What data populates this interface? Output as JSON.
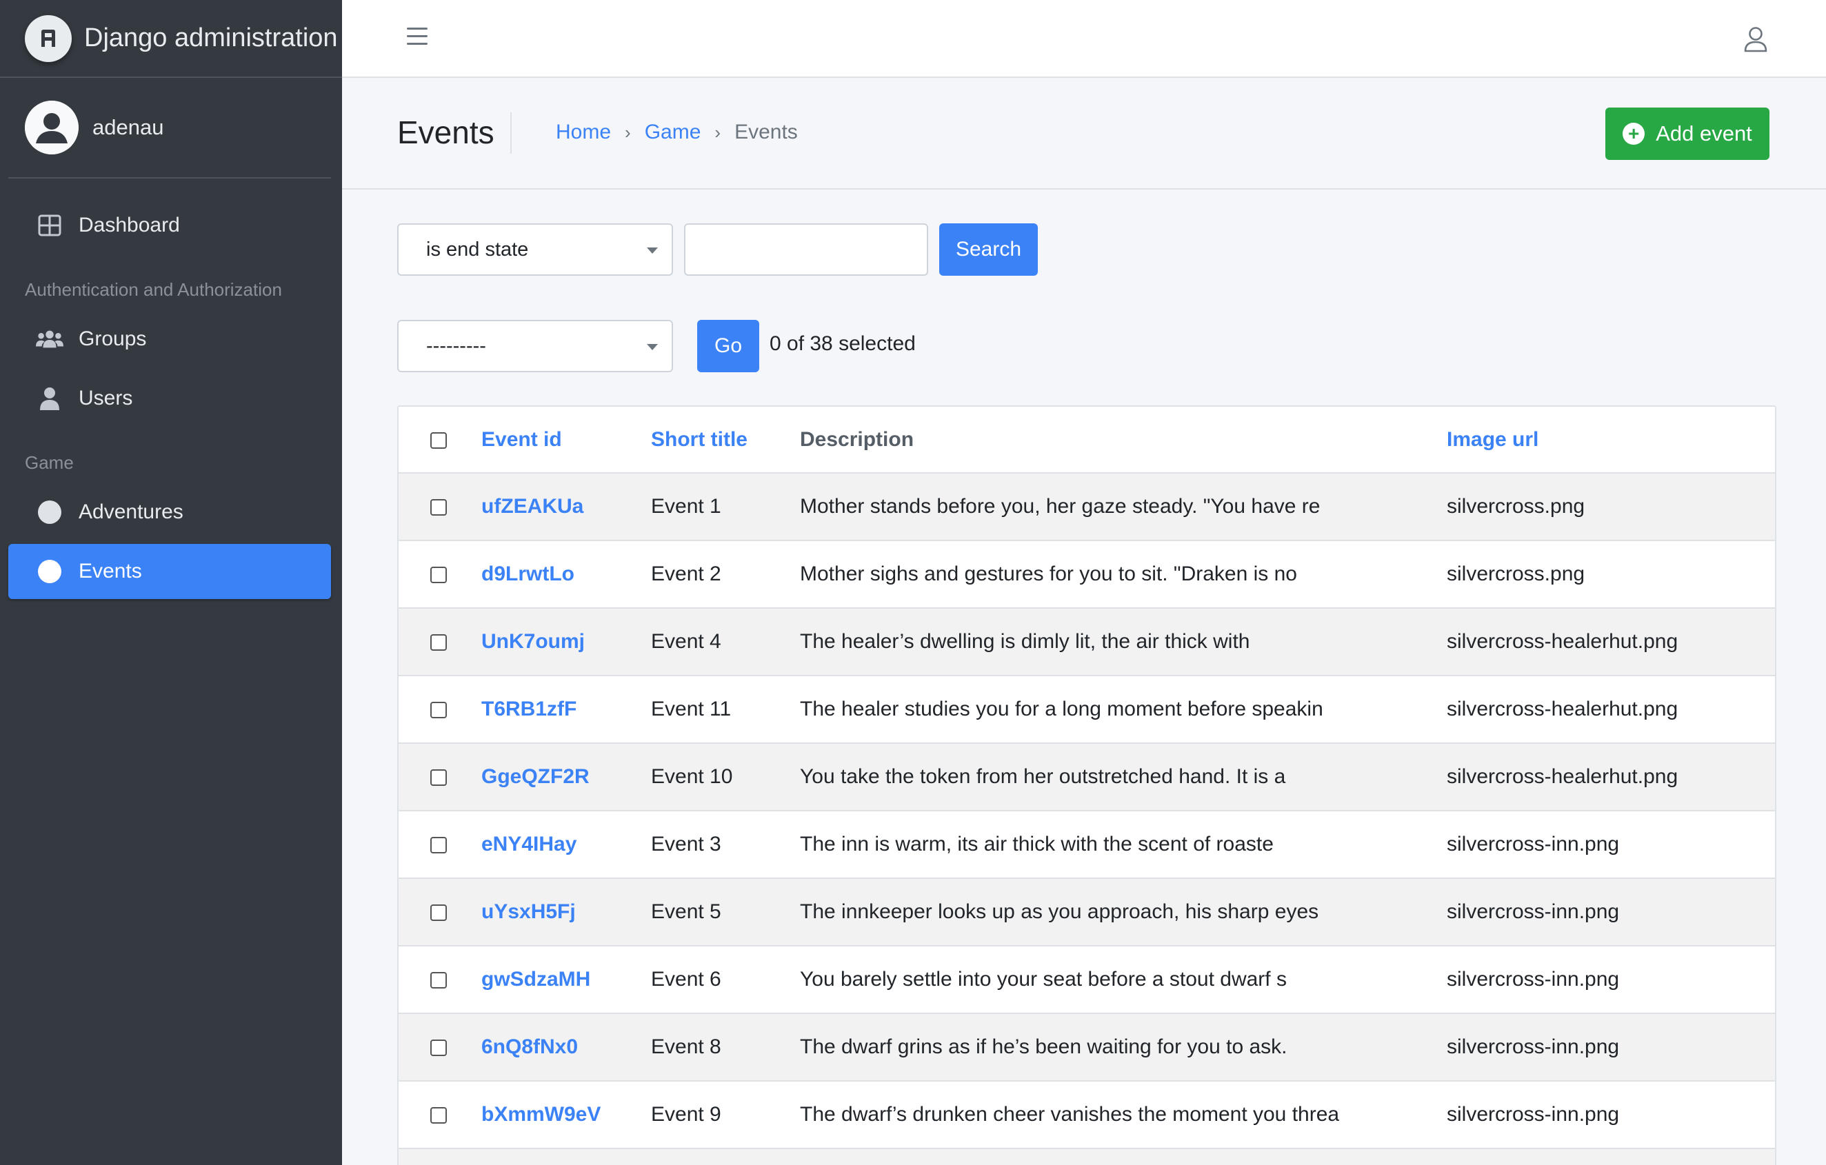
{
  "brand": {
    "title": "Django administration"
  },
  "user": {
    "name": "adenau"
  },
  "sidebar": {
    "dashboard": "Dashboard",
    "section_auth": "Authentication and Authorization",
    "groups": "Groups",
    "users": "Users",
    "section_game": "Game",
    "adventures": "Adventures",
    "events": "Events"
  },
  "header": {
    "title": "Events",
    "breadcrumb": [
      "Home",
      "Game",
      "Events"
    ],
    "add_button": "Add event"
  },
  "search": {
    "filter_value": "is end state",
    "input_value": "",
    "button": "Search"
  },
  "actions": {
    "select_value": "---------",
    "go_button": "Go",
    "selected_count": "0 of 38 selected"
  },
  "table": {
    "columns": [
      "Event id",
      "Short title",
      "Description",
      "Image url"
    ],
    "rows": [
      {
        "id": "ufZEAKUa",
        "title": "Event 1",
        "description": "Mother stands before you, her gaze steady. \"You have re",
        "image": "silvercross.png"
      },
      {
        "id": "d9LrwtLo",
        "title": "Event 2",
        "description": "Mother sighs and gestures for you to sit. \"Draken is no",
        "image": "silvercross.png"
      },
      {
        "id": "UnK7oumj",
        "title": "Event 4",
        "description": "The healer’s dwelling is dimly lit, the air thick with",
        "image": "silvercross-healerhut.png"
      },
      {
        "id": "T6RB1zfF",
        "title": "Event 11",
        "description": "The healer studies you for a long moment before speakin",
        "image": "silvercross-healerhut.png"
      },
      {
        "id": "GgeQZF2R",
        "title": "Event 10",
        "description": "You take the token from her outstretched hand. It is a",
        "image": "silvercross-healerhut.png"
      },
      {
        "id": "eNY4IHay",
        "title": "Event 3",
        "description": "The inn is warm, its air thick with the scent of roaste",
        "image": "silvercross-inn.png"
      },
      {
        "id": "uYsxH5Fj",
        "title": "Event 5",
        "description": "The innkeeper looks up as you approach, his sharp eyes",
        "image": "silvercross-inn.png"
      },
      {
        "id": "gwSdzaMH",
        "title": "Event 6",
        "description": "You barely settle into your seat before a stout dwarf s",
        "image": "silvercross-inn.png"
      },
      {
        "id": "6nQ8fNx0",
        "title": "Event 8",
        "description": "The dwarf grins as if he’s been waiting for you to ask.",
        "image": "silvercross-inn.png"
      },
      {
        "id": "bXmmW9eV",
        "title": "Event 9",
        "description": "The dwarf’s drunken cheer vanishes the moment you threa",
        "image": "silvercross-inn.png"
      }
    ]
  },
  "colors": {
    "primary": "#3b82f6",
    "success": "#28a745",
    "sidebar_bg": "#343a40"
  }
}
